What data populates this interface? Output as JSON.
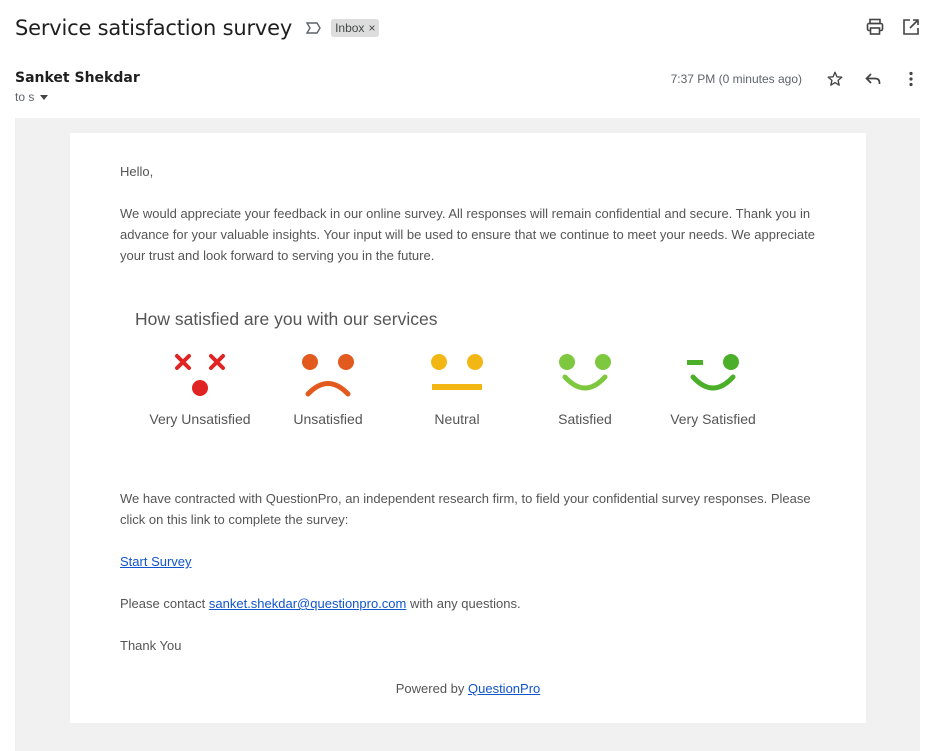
{
  "subject": "Service satisfaction survey",
  "label": "Inbox",
  "label_close": "×",
  "sender": "Sanket Shekdar",
  "to_line": "to s",
  "time": "7:37 PM (0 minutes ago)",
  "icons": {
    "importance": "importance-marker-icon",
    "print": "print-icon",
    "open_new": "open-in-new-window-icon",
    "star": "star-icon",
    "reply": "reply-icon",
    "more": "more-vert-icon"
  },
  "body": {
    "greeting": "Hello,",
    "intro": "We would appreciate your feedback in our online survey. All responses will remain confidential and secure. Thank you in advance for your valuable insights. Your input will be used to ensure that we continue to meet your needs. We appreciate your trust and look forward to serving you in the future.",
    "question": "How satisfied are you with our services",
    "faces": [
      {
        "label": "Very Unsatisfied",
        "color": "#e02424"
      },
      {
        "label": "Unsatisfied",
        "color": "#e25a1e"
      },
      {
        "label": "Neutral",
        "color": "#f3b715"
      },
      {
        "label": "Satisfied",
        "color": "#7ec840"
      },
      {
        "label": "Very Satisfied",
        "color": "#4caf2a"
      }
    ],
    "contract_text": "We have contracted with QuestionPro, an independent research firm, to field your confidential survey responses. Please click on this link to complete the survey:",
    "start_link": "Start Survey",
    "contact_prefix": "Please contact ",
    "contact_email": "sanket.shekdar@questionpro.com",
    "contact_suffix": " with any questions.",
    "thanks": "Thank You",
    "powered_prefix": "Powered by ",
    "powered_link": "QuestionPro"
  }
}
